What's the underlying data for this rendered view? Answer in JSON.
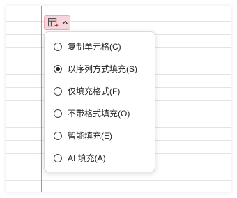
{
  "autofill_button": {
    "icon": "autofill-options-icon",
    "chevron": "chevron-up-icon",
    "accent_bg": "#f6d6dc",
    "accent_border": "#e9aab6"
  },
  "menu": {
    "items": [
      {
        "label": "复制单元格(C)",
        "checked": false
      },
      {
        "label": "以序列方式填充(S)",
        "checked": true
      },
      {
        "label": "仅填充格式(F)",
        "checked": false
      },
      {
        "label": "不带格式填充(O)",
        "checked": false
      },
      {
        "label": "智能填充(E)",
        "checked": false
      },
      {
        "label": "AI 填充(A)",
        "checked": false
      }
    ]
  }
}
